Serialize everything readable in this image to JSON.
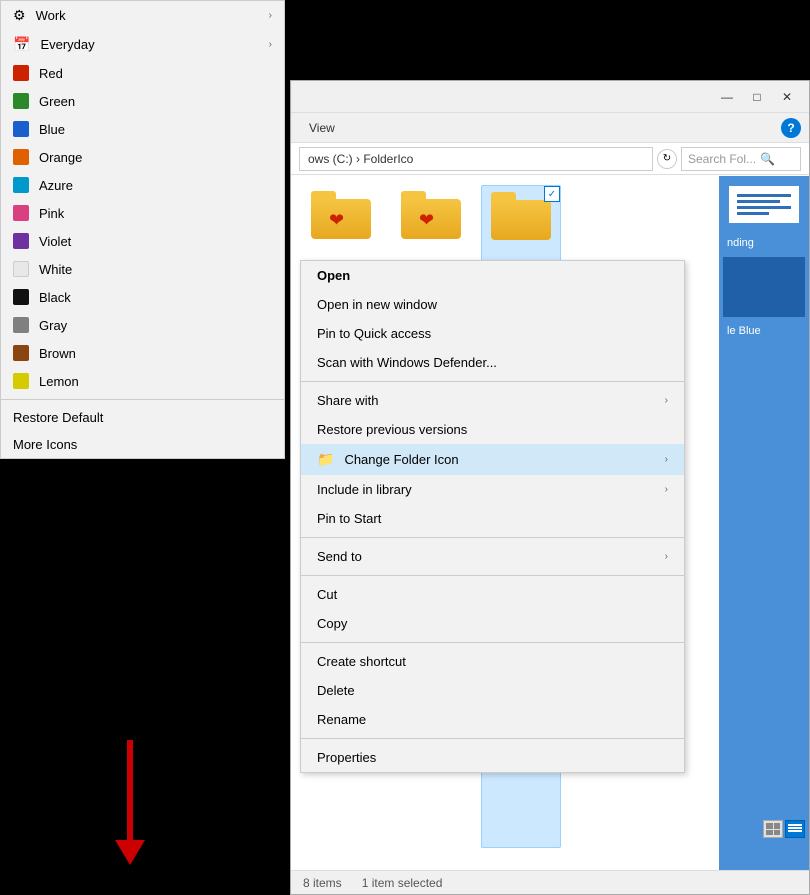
{
  "explorer": {
    "titlebar": {
      "minimize": "—",
      "maximize": "□",
      "close": "✕"
    },
    "toolbar": {
      "view_label": "View",
      "help_icon": "?"
    },
    "addressbar": {
      "path": "ows (C:) › FolderIco",
      "search_placeholder": "Search Fol...",
      "search_icon": "🔍"
    },
    "statusbar": {
      "items_count": "8 items",
      "selected": "1 item selected"
    }
  },
  "left_menu": {
    "items": [
      {
        "id": "work",
        "label": "Work",
        "color": null,
        "has_arrow": true,
        "icon": "gear"
      },
      {
        "id": "everyday",
        "label": "Everyday",
        "color": null,
        "has_arrow": true,
        "icon": "calendar"
      },
      {
        "id": "red",
        "label": "Red",
        "color": "#cc2200"
      },
      {
        "id": "green",
        "label": "Green",
        "color": "#2a8a2a"
      },
      {
        "id": "blue",
        "label": "Blue",
        "color": "#1a5fcc"
      },
      {
        "id": "orange",
        "label": "Orange",
        "color": "#e06000"
      },
      {
        "id": "azure",
        "label": "Azure",
        "color": "#0099cc"
      },
      {
        "id": "pink",
        "label": "Pink",
        "color": "#d94080"
      },
      {
        "id": "violet",
        "label": "Violet",
        "color": "#7030a0"
      },
      {
        "id": "white",
        "label": "White",
        "color": "#e8e8e8"
      },
      {
        "id": "black",
        "label": "Black",
        "color": "#111111"
      },
      {
        "id": "gray",
        "label": "Gray",
        "color": "#808080"
      },
      {
        "id": "brown",
        "label": "Brown",
        "color": "#8B4513"
      },
      {
        "id": "lemon",
        "label": "Lemon",
        "color": "#d4cc00"
      }
    ],
    "divider1": true,
    "restore_default": "Restore Default",
    "more_icons": "More Icons"
  },
  "right_menu": {
    "items": [
      {
        "id": "open",
        "label": "Open",
        "bold": true
      },
      {
        "id": "open-new-window",
        "label": "Open in new window"
      },
      {
        "id": "pin-quick",
        "label": "Pin to Quick access"
      },
      {
        "id": "scan-defender",
        "label": "Scan with Windows Defender..."
      },
      {
        "id": "divider1",
        "type": "divider"
      },
      {
        "id": "share-with",
        "label": "Share with",
        "has_sub": true
      },
      {
        "id": "restore-versions",
        "label": "Restore previous versions"
      },
      {
        "id": "change-folder-icon",
        "label": "Change Folder Icon",
        "has_sub": true,
        "highlighted": true,
        "icon": "folder-red"
      },
      {
        "id": "include-library",
        "label": "Include in library",
        "has_sub": true
      },
      {
        "id": "pin-start",
        "label": "Pin to Start"
      },
      {
        "id": "divider2",
        "type": "divider"
      },
      {
        "id": "send-to",
        "label": "Send to",
        "has_sub": true
      },
      {
        "id": "divider3",
        "type": "divider"
      },
      {
        "id": "cut",
        "label": "Cut"
      },
      {
        "id": "copy",
        "label": "Copy"
      },
      {
        "id": "divider4",
        "type": "divider"
      },
      {
        "id": "create-shortcut",
        "label": "Create shortcut"
      },
      {
        "id": "delete",
        "label": "Delete"
      },
      {
        "id": "rename",
        "label": "Rename"
      },
      {
        "id": "divider5",
        "type": "divider"
      },
      {
        "id": "properties",
        "label": "Properties"
      }
    ]
  },
  "bottom_text": {
    "partial_label": "le Blue"
  }
}
